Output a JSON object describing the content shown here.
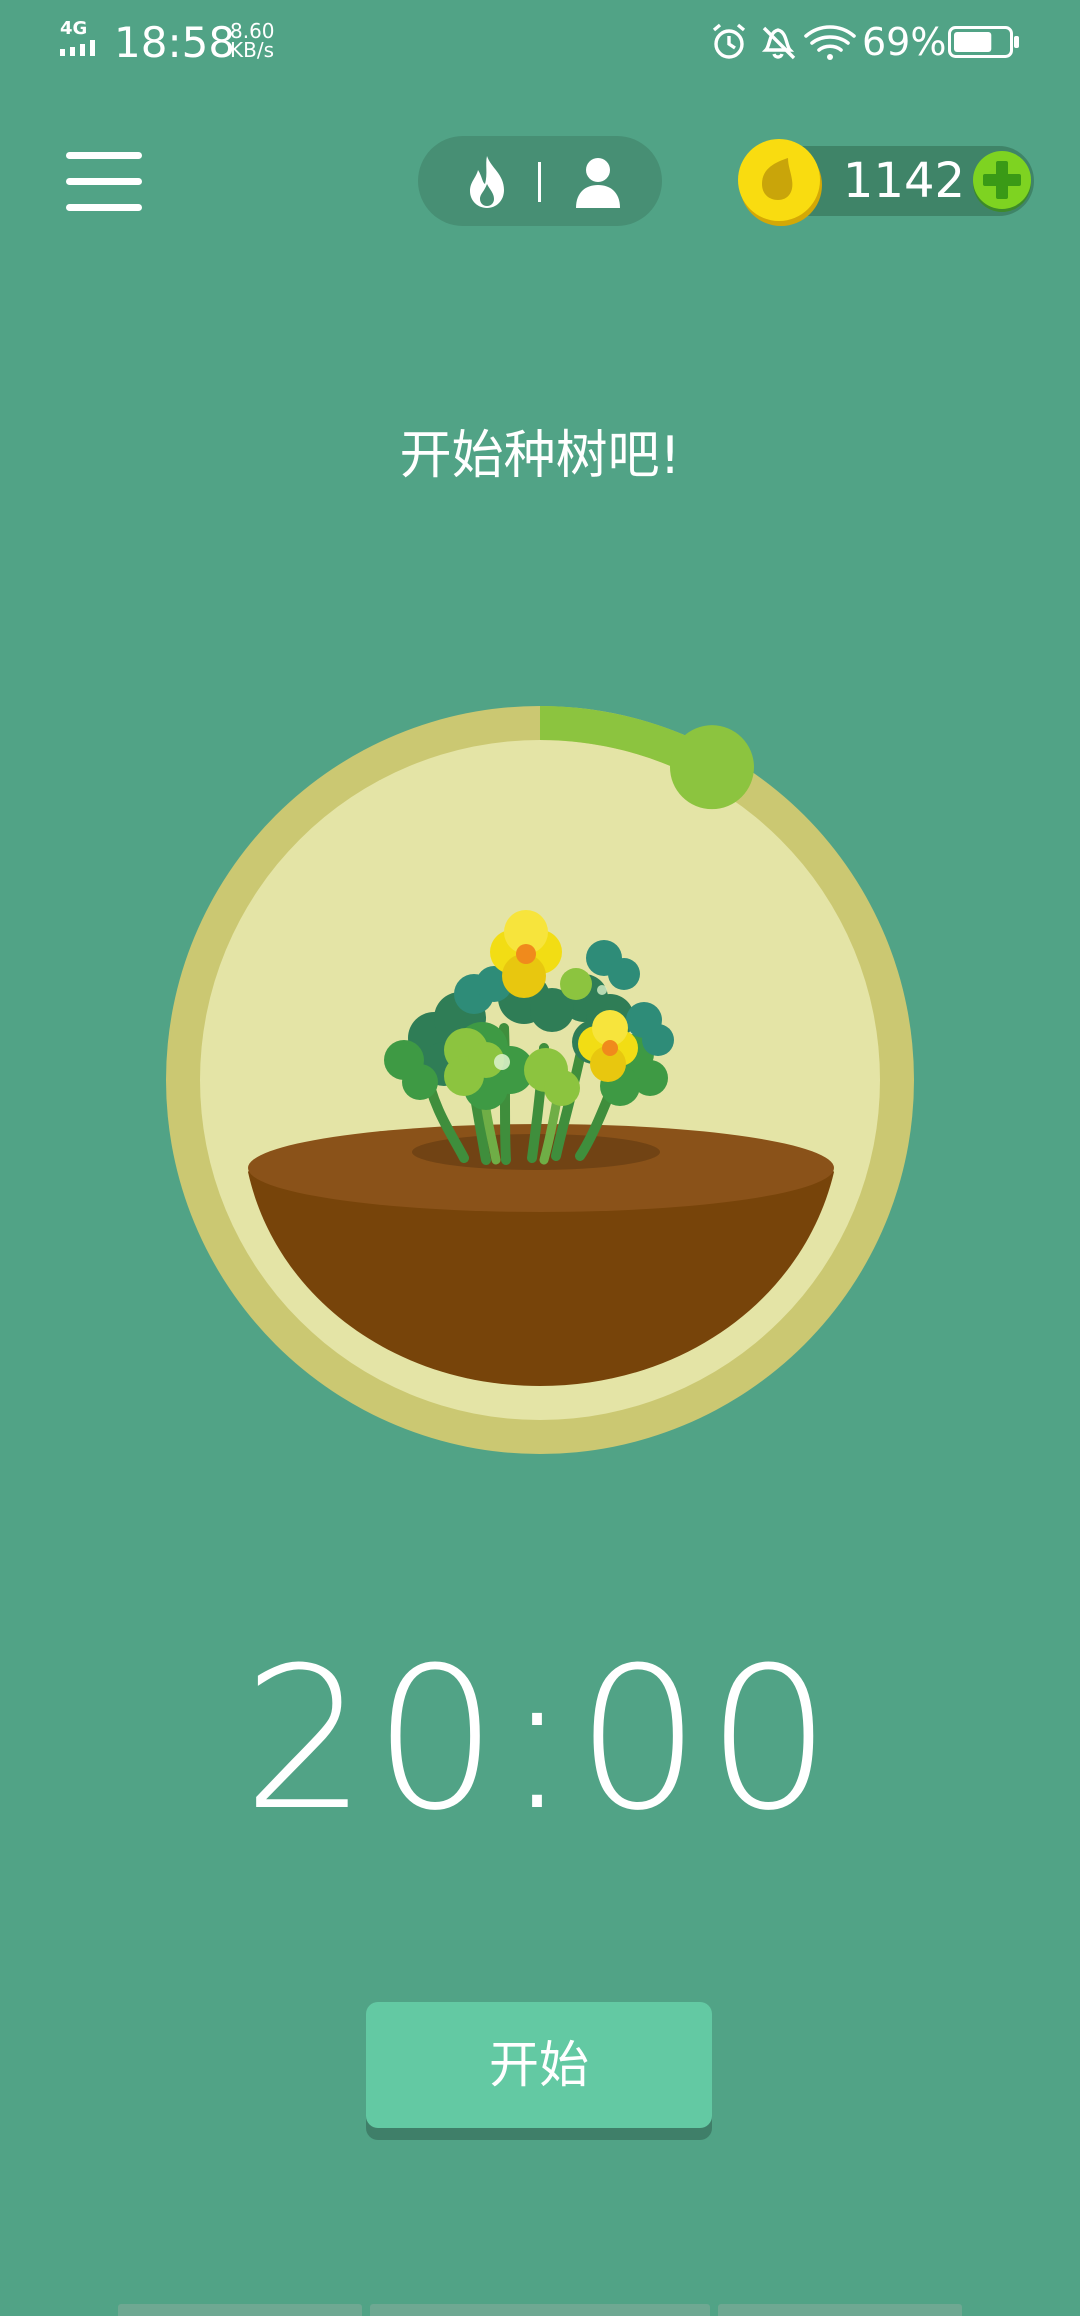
{
  "status_bar": {
    "network": "4G",
    "time": "18:58",
    "speed_value": "8.60",
    "speed_unit": "KB/s",
    "battery_percent": "69%",
    "battery_level": 0.69,
    "icons": [
      "signal-icon",
      "alarm-icon",
      "mute-icon",
      "wifi-icon",
      "battery-icon"
    ]
  },
  "header": {
    "menu_icon": "hamburger-menu-icon",
    "mode_toggle": {
      "left_icon": "fire-icon",
      "right_icon": "person-icon"
    },
    "coins": {
      "icon": "coin-icon",
      "count": "1142",
      "add_icon": "plus-icon"
    }
  },
  "main": {
    "prompt": "开始种树吧!",
    "dial": {
      "progress": 0.08,
      "illustration": "clover-plant-in-soil"
    },
    "timer": "20:00",
    "start_label": "开始"
  },
  "colors": {
    "background": "#51a386",
    "dial_ring": "#cbc872",
    "dial_face": "#e4e4a6",
    "progress": "#8cc43f",
    "soil": "#7a4712",
    "start_button": "#63c9a3",
    "coin": "#f5d90a",
    "plus_button": "#7ed321"
  }
}
